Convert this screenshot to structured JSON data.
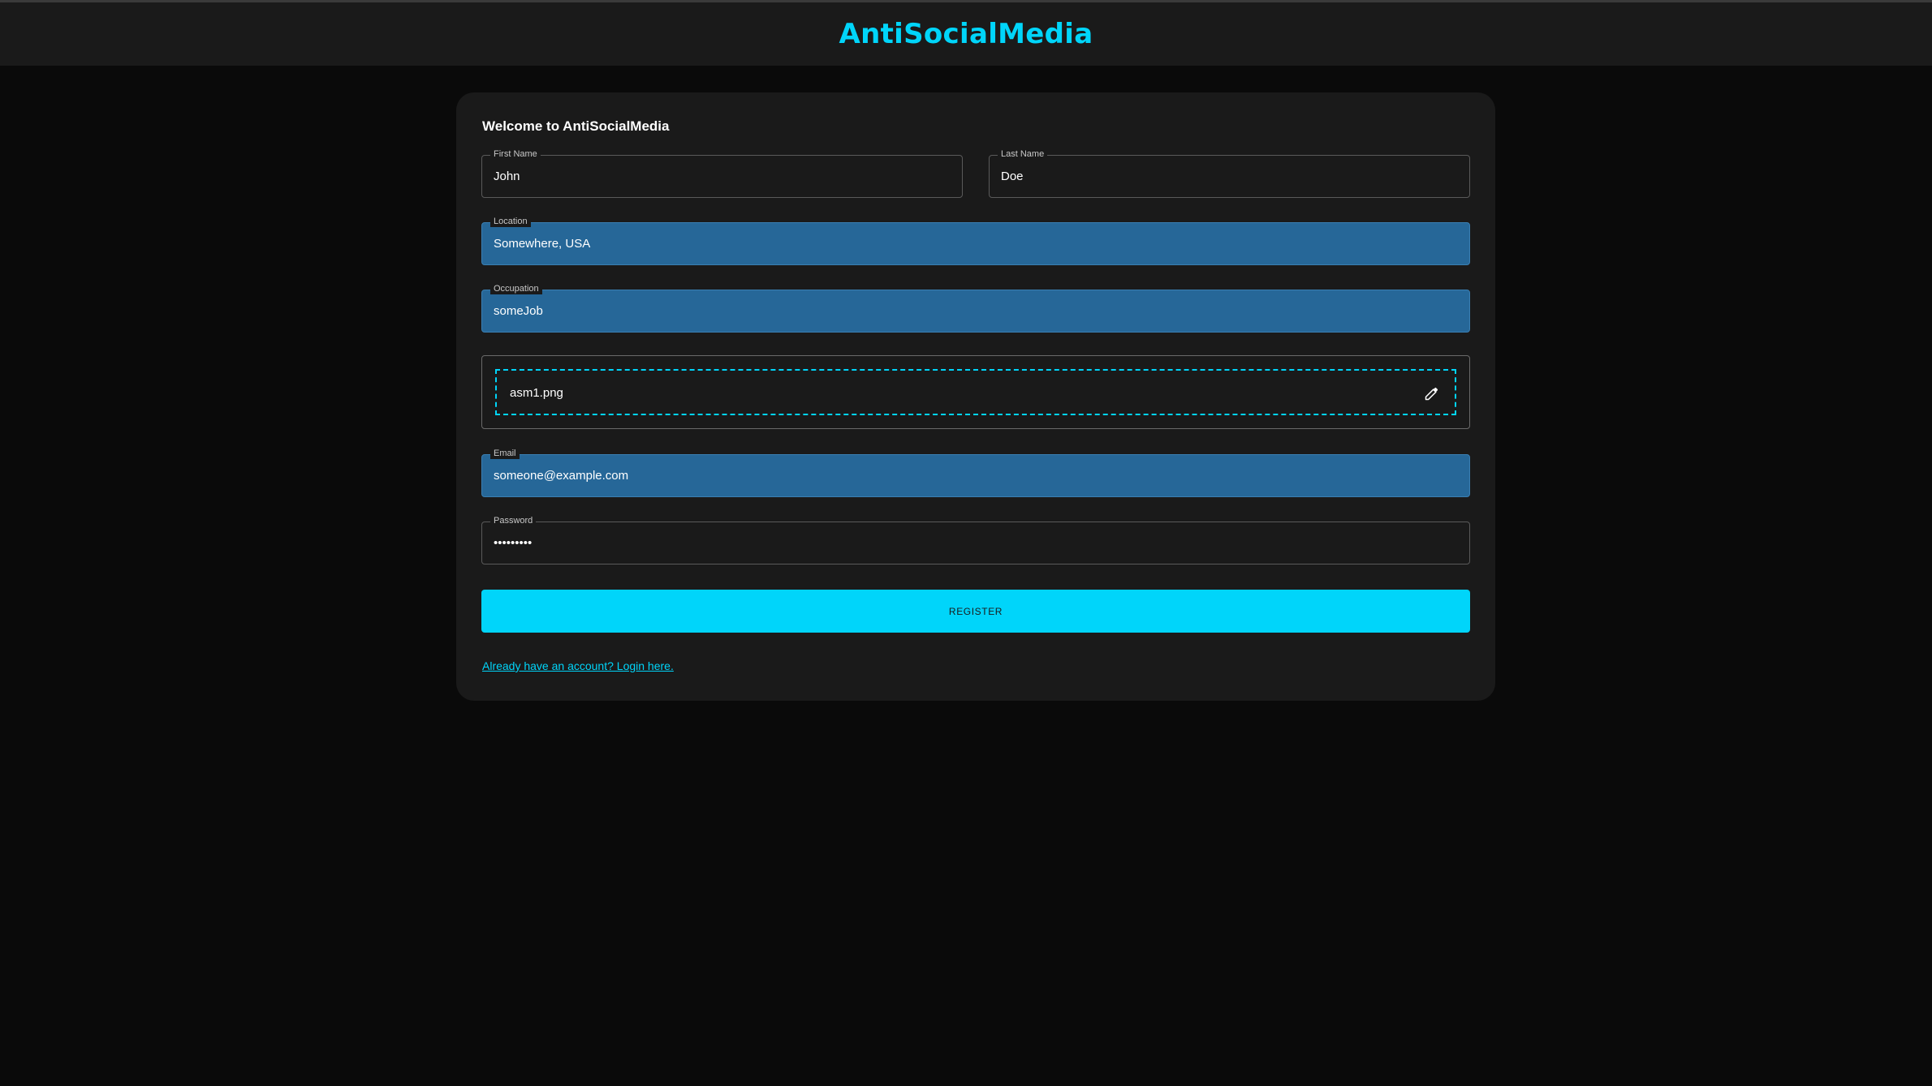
{
  "header": {
    "brand": "AntiSocialMedia"
  },
  "form": {
    "title": "Welcome to AntiSocialMedia",
    "first_name": {
      "label": "First Name",
      "value": "John"
    },
    "last_name": {
      "label": "Last Name",
      "value": "Doe"
    },
    "location": {
      "label": "Location",
      "value": "Somewhere, USA"
    },
    "occupation": {
      "label": "Occupation",
      "value": "someJob"
    },
    "picture": {
      "filename": "asm1.png",
      "icon": "edit-icon"
    },
    "email": {
      "label": "Email",
      "value": "someone@example.com"
    },
    "password": {
      "label": "Password",
      "value": "•••••••••"
    },
    "register_label": "REGISTER",
    "login_link": "Already have an account? Login here."
  },
  "colors": {
    "accent": "#00d5fa",
    "autofill": "#266798",
    "card": "#1a1a1a",
    "background": "#0a0a0a"
  }
}
